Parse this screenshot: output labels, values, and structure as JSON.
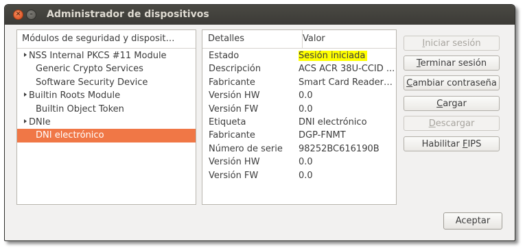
{
  "window": {
    "title": "Administrador de dispositivos"
  },
  "modules": {
    "header": "Módulos de seguridad y disposit…",
    "items": [
      {
        "label": "NSS Internal PKCS #11 Module",
        "level": 0
      },
      {
        "label": "Generic Crypto Services",
        "level": 1
      },
      {
        "label": "Software Security Device",
        "level": 1
      },
      {
        "label": "Builtin Roots Module",
        "level": 0
      },
      {
        "label": "Builtin Object Token",
        "level": 1
      },
      {
        "label": "DNIe",
        "level": 0
      },
      {
        "label": "DNI electrónico",
        "level": 1,
        "selected": true
      }
    ]
  },
  "details": {
    "header_key": "Detalles",
    "header_value": "Valor",
    "rows": [
      {
        "key": "Estado",
        "value": "Sesión iniciada"
      },
      {
        "key": "Descripción",
        "value": "ACS ACR 38U-CCID ..."
      },
      {
        "key": "Fabricante",
        "value": "Smart Card Reader…"
      },
      {
        "key": "Versión HW",
        "value": "0.0"
      },
      {
        "key": "Versión FW",
        "value": "0.0"
      },
      {
        "key": "Etiqueta",
        "value": "DNI electrónico"
      },
      {
        "key": "Fabricante",
        "value": "DGP-FNMT"
      },
      {
        "key": "Número de serie",
        "value": "98252BC616190B"
      },
      {
        "key": "Versión HW",
        "value": "0.0"
      },
      {
        "key": "Versión FW",
        "value": "0.0"
      }
    ]
  },
  "buttons": {
    "login": {
      "pre": "",
      "mn": "I",
      "post": "niciar sesión",
      "disabled": true
    },
    "logout": {
      "pre": "",
      "mn": "T",
      "post": "erminar sesión",
      "disabled": false
    },
    "change_password": {
      "pre": "",
      "mn": "C",
      "post": "ambiar contraseña",
      "disabled": false
    },
    "load": {
      "pre": "",
      "mn": "C",
      "post": "argar",
      "disabled": false
    },
    "unload": {
      "pre": "",
      "mn": "D",
      "post": "escargar",
      "disabled": true
    },
    "fips": {
      "pre": "Habilitar ",
      "mn": "F",
      "post": "IPS",
      "disabled": false
    },
    "accept": "Aceptar"
  },
  "colors": {
    "selection": "#f07746",
    "highlight": "#ffff00",
    "titlebar": "#3c3b37"
  }
}
